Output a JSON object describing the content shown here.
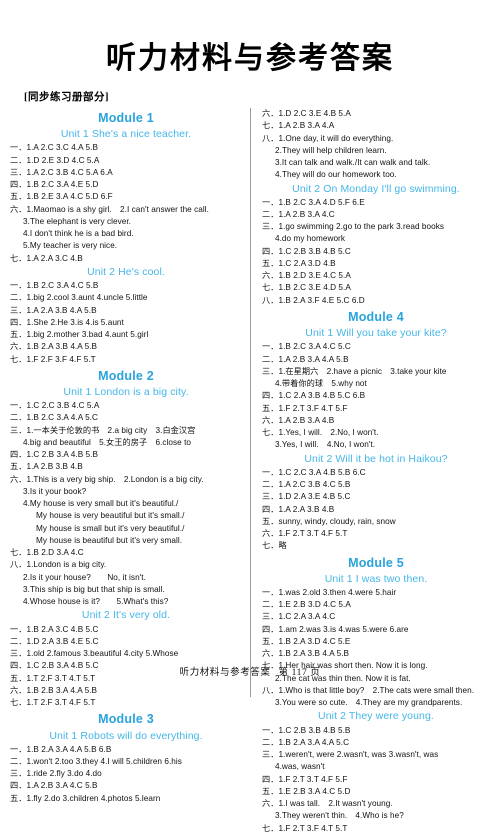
{
  "title": "听力材料与参考答案",
  "subtitle": "[同步练习册部分]",
  "footer": {
    "text": "听力材料与参考答案",
    "page": "第 117 页"
  },
  "colors": {
    "module": "#29a3dc",
    "unit": "#45b6e8",
    "text": "#111111"
  },
  "left_column": [
    {
      "type": "module",
      "text": "Module 1"
    },
    {
      "type": "unit",
      "text": "Unit 1 She's a nice teacher."
    },
    {
      "type": "answer",
      "text": "一．1.A  2.C  3.C  4.A  5.B"
    },
    {
      "type": "answer",
      "text": "二．1.D  2.E  3.D  4.C  5.A"
    },
    {
      "type": "answer",
      "text": "三．1.A  2.C  3.B  4.C  5.A  6.A"
    },
    {
      "type": "answer",
      "text": "四．1.B  2.C  3.A  4.E  5.D"
    },
    {
      "type": "answer",
      "text": "五．1.B  2.E  3.A  4.C  5.D  6.F"
    },
    {
      "type": "answer",
      "text": "六．1.Maomao is a shy girl.　2.I can't answer the call."
    },
    {
      "type": "answer",
      "indent": 1,
      "text": "3.The elephant is very clever."
    },
    {
      "type": "answer",
      "indent": 1,
      "text": "4.I don't think he is a bad bird."
    },
    {
      "type": "answer",
      "indent": 1,
      "text": "5.My teacher is very nice."
    },
    {
      "type": "answer",
      "text": "七．1.A  2.A  3.C  4.B"
    },
    {
      "type": "unit",
      "text": "Unit 2 He's cool."
    },
    {
      "type": "answer",
      "text": "一．1.B  2.C  3.A  4.C  5.B"
    },
    {
      "type": "answer",
      "text": "二．1.big  2.cool  3.aunt  4.uncle  5.little"
    },
    {
      "type": "answer",
      "text": "三．1.A  2.A  3.B  4.A  5.B"
    },
    {
      "type": "answer",
      "text": "四．1.She  2.He  3.is  4.is  5.aunt"
    },
    {
      "type": "answer",
      "text": "五．1.big  2.mother  3.bad  4.aunt  5.girl"
    },
    {
      "type": "answer",
      "text": "六．1.B  2.A  3.B  4.A  5.B"
    },
    {
      "type": "answer",
      "text": "七．1.F  2.F  3.F  4.F  5.T"
    },
    {
      "type": "module",
      "text": "Module 2"
    },
    {
      "type": "unit",
      "text": "Unit 1 London is a big city."
    },
    {
      "type": "answer",
      "text": "一．1.C  2.C  3.B  4.C  5.A"
    },
    {
      "type": "answer",
      "text": "二．1.B  2.C  3.A  4.A  5.C"
    },
    {
      "type": "answer",
      "text": "三．1.一本关于伦敦的书　2.a big city　3.白金汉宫"
    },
    {
      "type": "answer",
      "indent": 1,
      "text": "4.big and beautiful　5.女王的房子　6.close to"
    },
    {
      "type": "answer",
      "text": "四．1.C  2.B  3.A  4.B  5.B"
    },
    {
      "type": "answer",
      "text": "五．1.A  2.B  3.B  4.B"
    },
    {
      "type": "answer",
      "text": "六．1.This is a very big ship.　2.London is a big city."
    },
    {
      "type": "answer",
      "indent": 1,
      "text": "3.Is it your book?"
    },
    {
      "type": "answer",
      "indent": 1,
      "text": "4.My house is very small but it's beautiful./"
    },
    {
      "type": "answer",
      "indent": 2,
      "text": "My house is very beautiful but it's small./"
    },
    {
      "type": "answer",
      "indent": 2,
      "text": "My house is small but it's very beautiful./"
    },
    {
      "type": "answer",
      "indent": 2,
      "text": "My house is beautiful but it's very small."
    },
    {
      "type": "answer",
      "text": "七．1.B  2.D  3.A  4.C"
    },
    {
      "type": "answer",
      "text": "八．1.London is a big city."
    },
    {
      "type": "answer",
      "indent": 1,
      "text": "2.Is it your house?　　No, it isn't."
    },
    {
      "type": "answer",
      "indent": 1,
      "text": "3.This ship is big but that ship is small."
    },
    {
      "type": "answer",
      "indent": 1,
      "text": "4.Whose house is it?　　5.What's this?"
    },
    {
      "type": "unit",
      "text": "Unit 2 It's very old."
    },
    {
      "type": "answer",
      "text": "一．1.B  2.A  3.C  4.B  5.C"
    },
    {
      "type": "answer",
      "text": "二．1.D  2.A  3.B  4.E  5.C"
    },
    {
      "type": "answer",
      "text": "三．1.old  2.famous  3.beautiful  4.city  5.Whose"
    },
    {
      "type": "answer",
      "text": "四．1.C  2.B  3.A  4.B  5.C"
    },
    {
      "type": "answer",
      "text": "五．1.T  2.F  3.T  4.T  5.T"
    },
    {
      "type": "answer",
      "text": "六．1.B  2.B  3.A  4.A  5.B"
    },
    {
      "type": "answer",
      "text": "七．1.T  2.F  3.T  4.F  5.T"
    },
    {
      "type": "module",
      "text": "Module 3"
    },
    {
      "type": "unit",
      "text": "Unit 1 Robots will do everything."
    },
    {
      "type": "answer",
      "text": "一．1.B  2.A  3.A  4.A  5.B  6.B"
    },
    {
      "type": "answer",
      "text": "二．1.won't  2.too  3.they  4.I will  5.children  6.his"
    },
    {
      "type": "answer",
      "text": "三．1.ride  2.fly  3.do  4.do"
    },
    {
      "type": "answer",
      "text": "四．1.A  2.B  3.A  4.C  5.B"
    },
    {
      "type": "answer",
      "text": "五．1.fly  2.do  3.children  4.photos  5.learn"
    }
  ],
  "right_column": [
    {
      "type": "answer",
      "text": "六．1.D  2.C  3.E  4.B  5.A"
    },
    {
      "type": "answer",
      "text": "七．1.A  2.B  3.A  4.A"
    },
    {
      "type": "answer",
      "text": "八．1.One day, it will do everything."
    },
    {
      "type": "answer",
      "indent": 1,
      "text": "2.They will help children learn."
    },
    {
      "type": "answer",
      "indent": 1,
      "text": "3.It can talk and walk./It can walk and talk."
    },
    {
      "type": "answer",
      "indent": 1,
      "text": "4.They will do our homework too."
    },
    {
      "type": "unit",
      "text": "Unit 2 On Monday I'll go swimming."
    },
    {
      "type": "answer",
      "text": "一．1.B  2.C  3.A  4.D  5.F  6.E"
    },
    {
      "type": "answer",
      "text": "二．1.A  2.B  3.A  4.C"
    },
    {
      "type": "answer",
      "text": "三．1.go swimming  2.go to the park  3.read books"
    },
    {
      "type": "answer",
      "indent": 1,
      "text": "4.do my homework"
    },
    {
      "type": "answer",
      "text": "四．1.C  2.B  3.B  4.B  5.C"
    },
    {
      "type": "answer",
      "text": "五．1.C  2.A  3.D  4.B"
    },
    {
      "type": "answer",
      "text": "六．1.B  2.D  3.E  4.C  5.A"
    },
    {
      "type": "answer",
      "text": "七．1.B  2.C  3.E  4.D  5.A"
    },
    {
      "type": "answer",
      "text": "八．1.B  2.A  3.F  4.E  5.C  6.D"
    },
    {
      "type": "module",
      "text": "Module 4"
    },
    {
      "type": "unit",
      "text": "Unit 1 Will you take your kite?"
    },
    {
      "type": "answer",
      "text": "一．1.B  2.C  3.A  4.C  5.C"
    },
    {
      "type": "answer",
      "text": "二．1.A  2.B  3.A  4.A  5.B"
    },
    {
      "type": "answer",
      "text": "三．1.在星期六　2.have a picnic　3.take your kite"
    },
    {
      "type": "answer",
      "indent": 1,
      "text": "4.带着你的球　5.why not"
    },
    {
      "type": "answer",
      "text": "四．1.C  2.A  3.B  4.B  5.C  6.B"
    },
    {
      "type": "answer",
      "text": "五．1.F  2.T  3.F  4.T  5.F"
    },
    {
      "type": "answer",
      "text": "六．1.A  2.B  3.A  4.B"
    },
    {
      "type": "answer",
      "text": "七．1.Yes, I will.　2.No, I won't."
    },
    {
      "type": "answer",
      "indent": 1,
      "text": "3.Yes, I will.　4.No, I won't."
    },
    {
      "type": "unit",
      "text": "Unit 2 Will it be hot in Haikou?"
    },
    {
      "type": "answer",
      "text": "一．1.C  2.C  3.A  4.B  5.B  6.C"
    },
    {
      "type": "answer",
      "text": "二．1.A  2.C  3.B  4.C  5.B"
    },
    {
      "type": "answer",
      "text": "三．1.D  2.A  3.E  4.B  5.C"
    },
    {
      "type": "answer",
      "text": "四．1.A  2.A  3.B  4.B"
    },
    {
      "type": "answer",
      "text": "五．sunny, windy, cloudy, rain, snow"
    },
    {
      "type": "answer",
      "text": "六．1.F  2.T  3.T  4.F  5.T"
    },
    {
      "type": "answer",
      "text": "七．略"
    },
    {
      "type": "module",
      "text": "Module 5"
    },
    {
      "type": "unit",
      "text": "Unit 1 I was two then."
    },
    {
      "type": "answer",
      "text": "一．1.was  2.old  3.then  4.were  5.hair"
    },
    {
      "type": "answer",
      "text": "二．1.E  2.B  3.D  4.C  5.A"
    },
    {
      "type": "answer",
      "text": "三．1.C  2.A  3.A  4.C"
    },
    {
      "type": "answer",
      "text": "四．1.am  2.was  3.is  4.was  5.were  6.are"
    },
    {
      "type": "answer",
      "text": "五．1.B  2.A  3.D  4.C  5.E"
    },
    {
      "type": "answer",
      "text": "六．1.B  2.A  3.B  4.A  5.B"
    },
    {
      "type": "answer",
      "text": "七．1.Her hair was short then. Now it is long."
    },
    {
      "type": "answer",
      "indent": 1,
      "text": "2.The cat was thin then. Now it is fat."
    },
    {
      "type": "answer",
      "text": "八．1.Who is that little boy?　2.The cats were small then."
    },
    {
      "type": "answer",
      "indent": 1,
      "text": "3.You were so cute.　4.They are my grandparents."
    },
    {
      "type": "unit",
      "text": "Unit 2 They were young."
    },
    {
      "type": "answer",
      "text": "一．1.C  2.B  3.B  4.B  5.B"
    },
    {
      "type": "answer",
      "text": "二．1.B  2.A  3.A  4.A  5.C"
    },
    {
      "type": "answer",
      "text": "三．1.weren't, were  2.wasn't, was  3.wasn't, was"
    },
    {
      "type": "answer",
      "indent": 1,
      "text": "4.was, wasn't"
    },
    {
      "type": "answer",
      "text": "四．1.F  2.T  3.T  4.F  5.F"
    },
    {
      "type": "answer",
      "text": "五．1.E  2.B  3.A  4.C  5.D"
    },
    {
      "type": "answer",
      "text": "六．1.I was tall.　2.It wasn't young."
    },
    {
      "type": "answer",
      "indent": 1,
      "text": "3.They weren't thin.　4.Who is he?"
    },
    {
      "type": "answer",
      "text": "七．1.F  2.T  3.F  4.T  5.T"
    }
  ]
}
